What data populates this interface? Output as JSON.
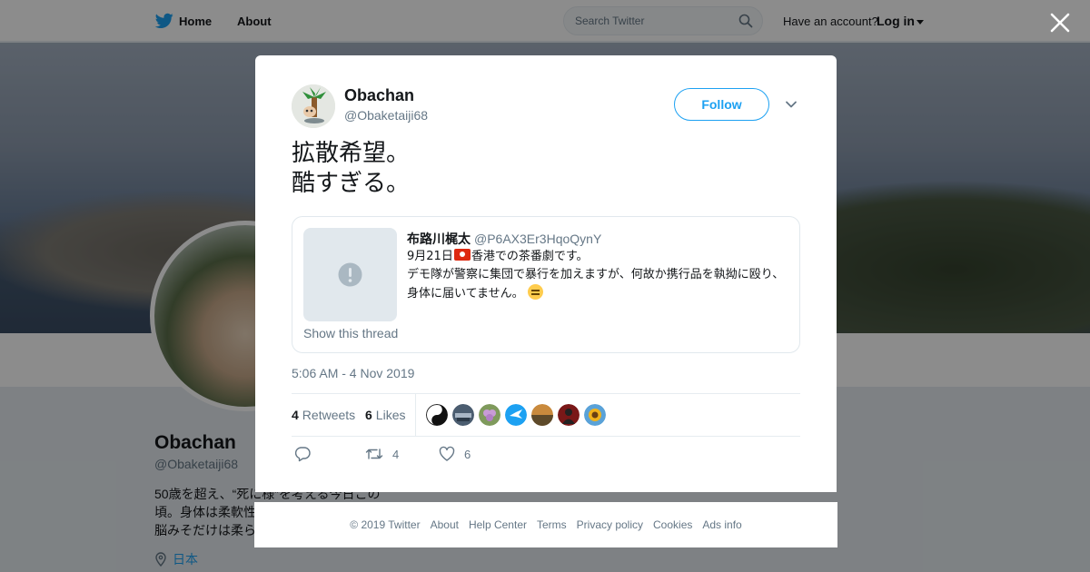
{
  "nav": {
    "home_label": "Home",
    "about_label": "About",
    "search_placeholder": "Search Twitter",
    "have_account": "Have an account?",
    "login_label": "Log in"
  },
  "background_profile": {
    "name": "Obachan",
    "handle": "@Obaketaiji68",
    "bio": "50歳を超え、“死に様”を考える今日この頃。身体は柔軟性\n脳みそだけは柔ら",
    "location": "日本"
  },
  "tweet": {
    "author_name": "Obachan",
    "author_handle": "@Obaketaiji68",
    "follow_label": "Follow",
    "text": "拡散希望。\n酷すぎる。",
    "timestamp": "5:06 AM - 4 Nov 2019",
    "retweets_count": "4",
    "retweets_label": "Retweets",
    "likes_count": "6",
    "likes_label": "Likes",
    "action_retweet_count": "4",
    "action_like_count": "6"
  },
  "quoted": {
    "name": "布路川梶太",
    "handle": "@P6AX3Er3HqoQynY",
    "text_line1_before_flag": "9月21日",
    "text_line1_after_flag": "香港での茶番劇です。",
    "text_line2": "デモ隊が警察に集団で暴行を加えますが、何故か携行品を執拗に殴り、身体に届いてません。",
    "show_thread": "Show this thread"
  },
  "likers": [
    {
      "icon": "yin-yang-avatar",
      "color": "#ffffff"
    },
    {
      "icon": "city-avatar",
      "color": "#5a6b7d"
    },
    {
      "icon": "flower-avatar",
      "color": "#8aa56a"
    },
    {
      "icon": "bird-avatar",
      "color": "#1da1f2"
    },
    {
      "icon": "landscape-avatar",
      "color": "#8a6a3a"
    },
    {
      "icon": "dark-figure-avatar",
      "color": "#8a2020"
    },
    {
      "icon": "sunflower-avatar",
      "color": "#e0a020"
    }
  ],
  "footer": {
    "copyright": "© 2019 Twitter",
    "about": "About",
    "help": "Help Center",
    "terms": "Terms",
    "privacy": "Privacy policy",
    "cookies": "Cookies",
    "ads": "Ads info"
  },
  "colors": {
    "accent": "#1da1f2",
    "text_primary": "#14171a",
    "text_secondary": "#657786"
  }
}
